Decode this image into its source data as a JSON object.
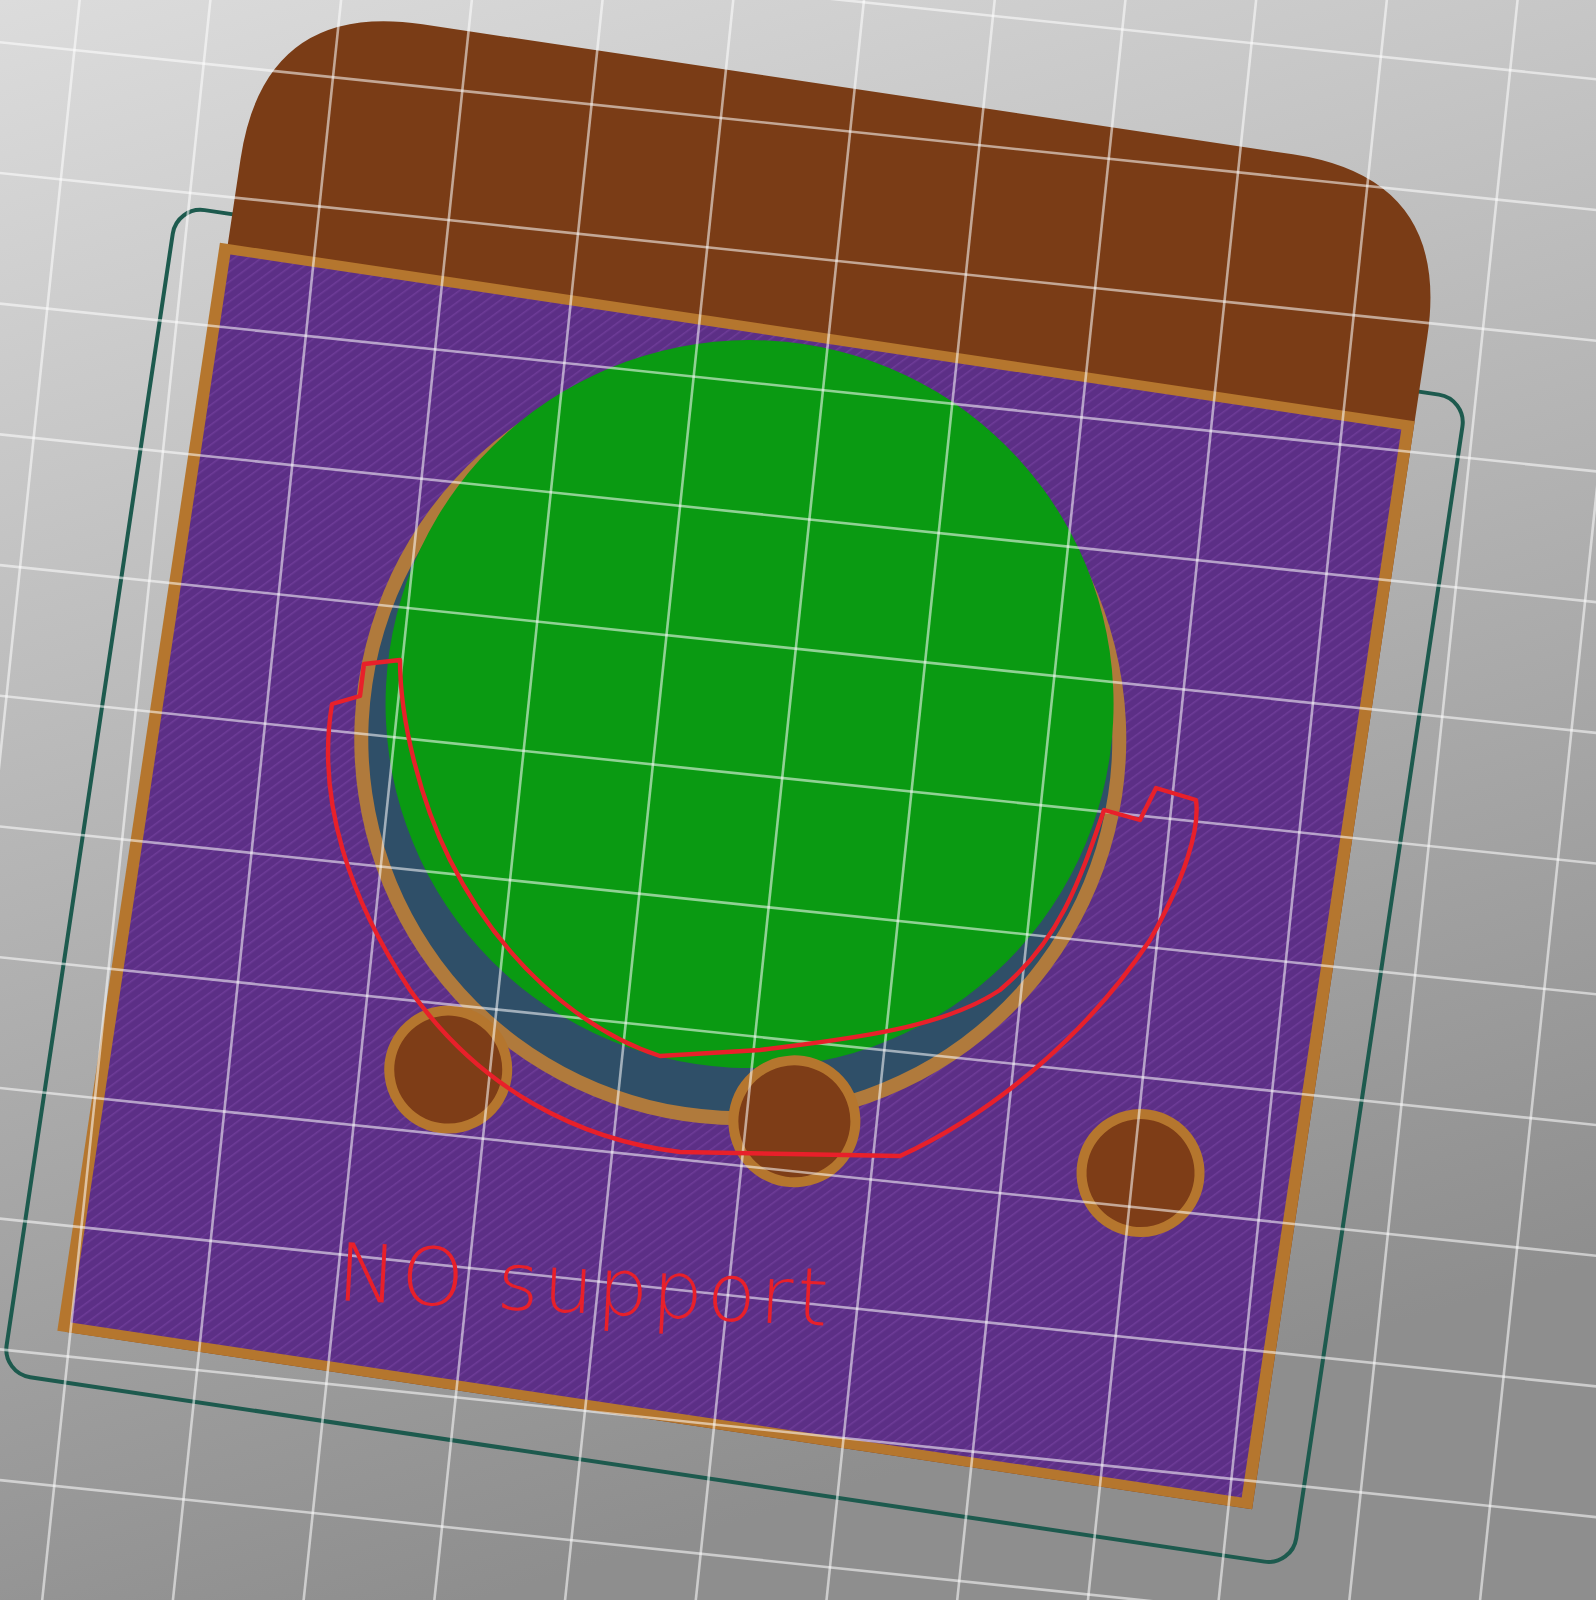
{
  "viewport": {
    "annotation": {
      "text": "NO support"
    }
  }
}
